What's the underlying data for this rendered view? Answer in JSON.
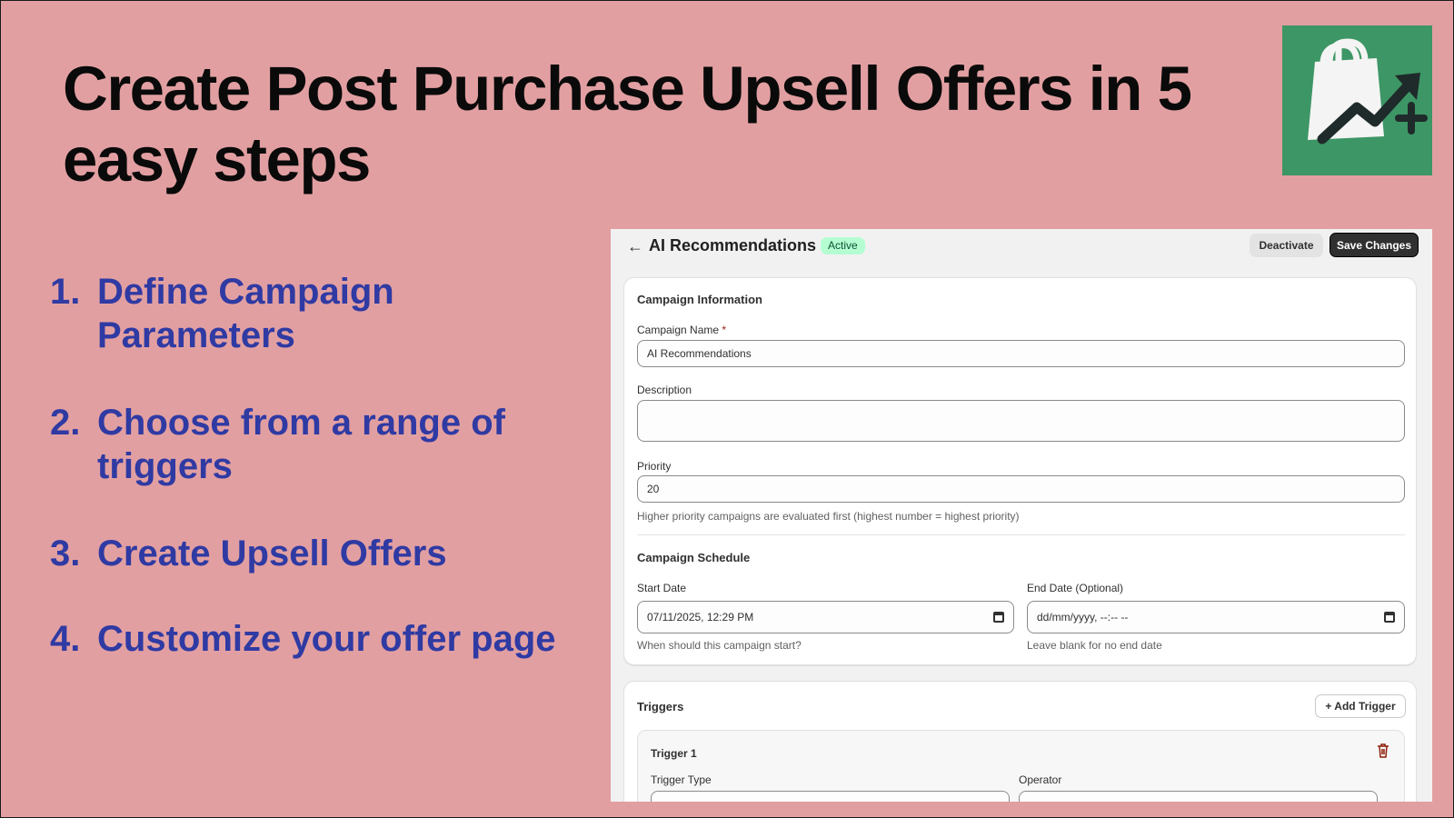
{
  "headline": "Create Post Purchase Upsell Offers in 5 easy steps",
  "colors": {
    "background": "#e29fa1",
    "steps_text": "#2f3aa3",
    "logo_bg": "#3d9665"
  },
  "logo": {
    "icon": "shopping-bag-growth-icon"
  },
  "steps": [
    {
      "num": "1.",
      "text": "Define Campaign Parameters"
    },
    {
      "num": "2.",
      "text": "Choose from a range of triggers"
    },
    {
      "num": "3.",
      "text": "Create Upsell Offers"
    },
    {
      "num": "4.",
      "text": "Customize your offer page"
    }
  ],
  "app": {
    "title": "AI Recommendations",
    "status_badge": "Active",
    "deactivate_label": "Deactivate",
    "save_label": "Save Changes",
    "campaign_info": {
      "section_title": "Campaign Information",
      "name_label": "Campaign Name",
      "name_required": "*",
      "name_value": "AI Recommendations",
      "description_label": "Description",
      "description_value": "",
      "priority_label": "Priority",
      "priority_value": "20",
      "priority_help": "Higher priority campaigns are evaluated first (highest number = highest priority)"
    },
    "schedule": {
      "section_title": "Campaign Schedule",
      "start_label": "Start Date",
      "start_value": "07/11/2025, 12:29 PM",
      "start_help": "When should this campaign start?",
      "end_label": "End Date (Optional)",
      "end_value": "dd/mm/yyyy, --:-- --",
      "end_help": "Leave blank for no end date"
    },
    "triggers": {
      "section_title": "Triggers",
      "add_label": "Add Trigger",
      "trigger_title": "Trigger 1",
      "type_label": "Trigger Type",
      "operator_label": "Operator"
    }
  }
}
